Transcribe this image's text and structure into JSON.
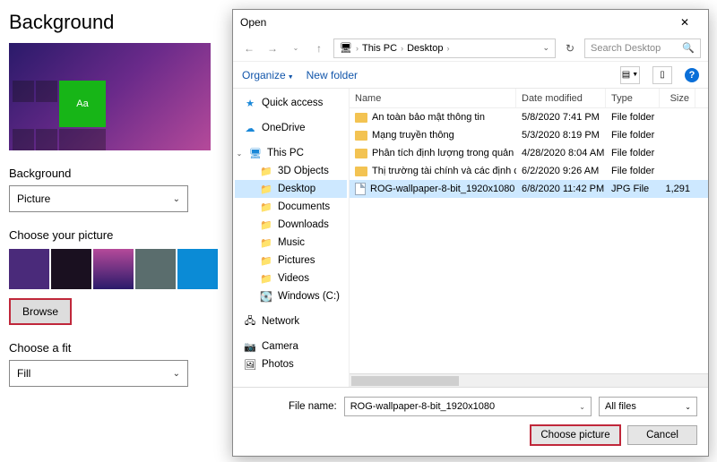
{
  "settings": {
    "title": "Background",
    "preview_tile_text": "Aa",
    "bg_label": "Background",
    "bg_value": "Picture",
    "choose_label": "Choose your picture",
    "browse_label": "Browse",
    "fit_label": "Choose a fit",
    "fit_value": "Fill"
  },
  "dialog": {
    "title": "Open",
    "path": {
      "root_icon": "🖥",
      "p1": "This PC",
      "p2": "Desktop"
    },
    "search_placeholder": "Search Desktop",
    "toolbar": {
      "organize": "Organize",
      "newfolder": "New folder"
    },
    "tree": {
      "quick": "Quick access",
      "onedrive": "OneDrive",
      "thispc": "This PC",
      "items": [
        "3D Objects",
        "Desktop",
        "Documents",
        "Downloads",
        "Music",
        "Pictures",
        "Videos",
        "Windows (C:)"
      ],
      "network": "Network",
      "camera": "Camera",
      "photos": "Photos"
    },
    "cols": {
      "name": "Name",
      "date": "Date modified",
      "type": "Type",
      "size": "Size"
    },
    "rows": [
      {
        "name": "An toàn bảo mật thông tin",
        "date": "5/8/2020 7:41 PM",
        "type": "File folder",
        "size": "",
        "kind": "folder"
      },
      {
        "name": "Mạng truyền thông",
        "date": "5/3/2020 8:19 PM",
        "type": "File folder",
        "size": "",
        "kind": "folder"
      },
      {
        "name": "Phân tích định lượng trong quản trị",
        "date": "4/28/2020 8:04 AM",
        "type": "File folder",
        "size": "",
        "kind": "folder"
      },
      {
        "name": "Thị trường tài chính và các định chế tài c...",
        "date": "6/2/2020 9:26 AM",
        "type": "File folder",
        "size": "",
        "kind": "folder"
      },
      {
        "name": "ROG-wallpaper-8-bit_1920x1080",
        "date": "6/8/2020 11:42 PM",
        "type": "JPG File",
        "size": "1,291",
        "kind": "file",
        "selected": true
      }
    ],
    "footer": {
      "filename_lbl": "File name:",
      "filename_val": "ROG-wallpaper-8-bit_1920x1080",
      "filter": "All files",
      "choose": "Choose picture",
      "cancel": "Cancel"
    }
  }
}
